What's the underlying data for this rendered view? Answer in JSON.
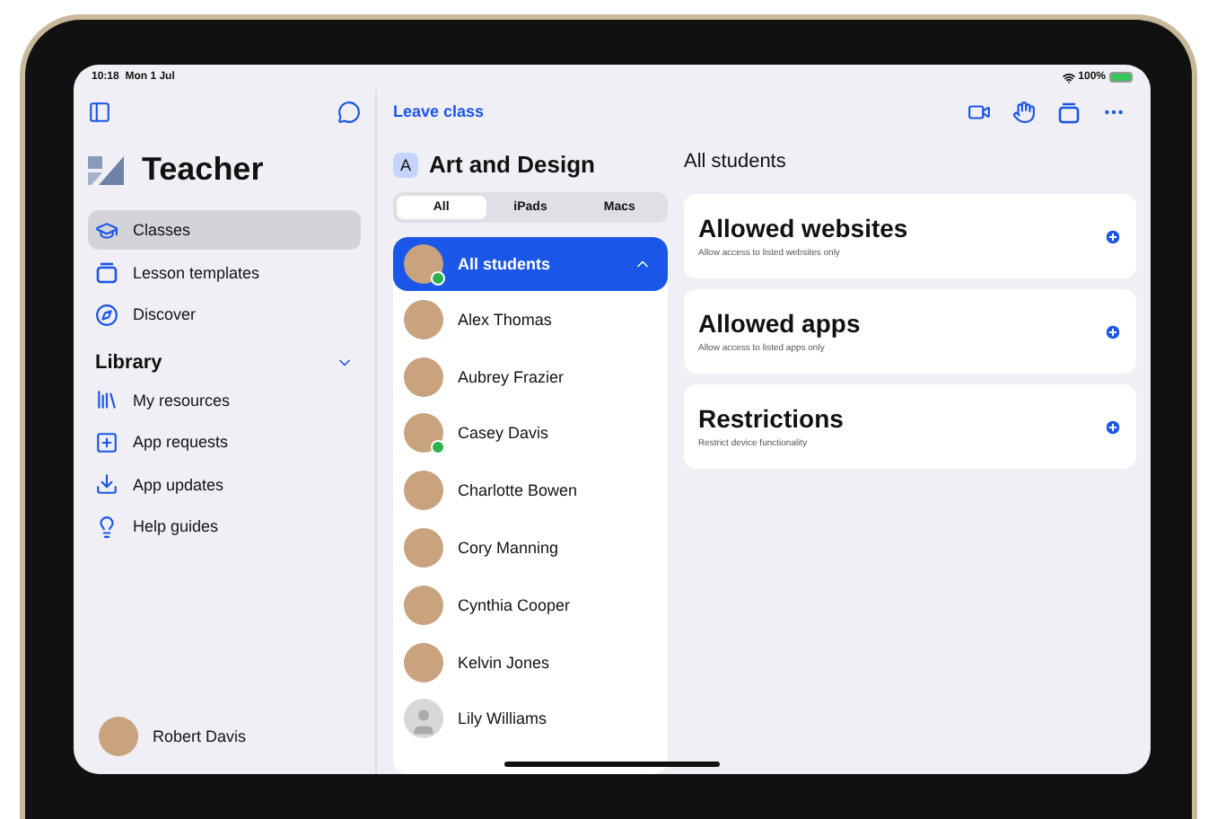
{
  "status_bar": {
    "time": "10:18",
    "date": "Mon 1 Jul",
    "battery": "100%"
  },
  "sidebar": {
    "app_title": "Teacher",
    "items": [
      {
        "label": "Classes",
        "kind": "classes",
        "selected": true
      },
      {
        "label": "Lesson templates",
        "kind": "templates",
        "selected": false
      },
      {
        "label": "Discover",
        "kind": "discover",
        "selected": false
      }
    ],
    "library": {
      "title": "Library",
      "expanded": true,
      "items": [
        {
          "label": "My resources",
          "kind": "resources",
          "selected": false
        },
        {
          "label": "App requests",
          "kind": "requests",
          "selected": false
        },
        {
          "label": "App updates",
          "kind": "updates",
          "selected": false
        },
        {
          "label": "Help guides",
          "kind": "help",
          "selected": false
        }
      ]
    },
    "user": {
      "name": "Robert Davis"
    }
  },
  "toolbar": {
    "leave_class": "Leave class"
  },
  "class": {
    "badge": "A",
    "name": "Art and Design",
    "segments": [
      {
        "label": "All",
        "selected": true
      },
      {
        "label": "iPads",
        "selected": false
      },
      {
        "label": "Macs",
        "selected": false
      }
    ],
    "group": {
      "label": "All students",
      "selected": true,
      "online": true
    },
    "students": [
      {
        "name": "Alex Thomas",
        "online": false,
        "kind": "photo"
      },
      {
        "name": "Aubrey Frazier",
        "online": false,
        "kind": "photo"
      },
      {
        "name": "Casey Davis",
        "online": true,
        "kind": "photo"
      },
      {
        "name": "Charlotte Bowen",
        "online": false,
        "kind": "photo"
      },
      {
        "name": "Cory Manning",
        "online": false,
        "kind": "photo"
      },
      {
        "name": "Cynthia Cooper",
        "online": false,
        "kind": "photo"
      },
      {
        "name": "Kelvin Jones",
        "online": false,
        "kind": "photo"
      },
      {
        "name": "Lily Williams",
        "online": false,
        "kind": "silhouette"
      }
    ]
  },
  "detail": {
    "title": "All students",
    "cards": [
      {
        "title": "Allowed websites",
        "subtitle": "Allow access to listed websites only"
      },
      {
        "title": "Allowed apps",
        "subtitle": "Allow access to listed apps only"
      },
      {
        "title": "Restrictions",
        "subtitle": "Restrict device functionality"
      }
    ]
  }
}
